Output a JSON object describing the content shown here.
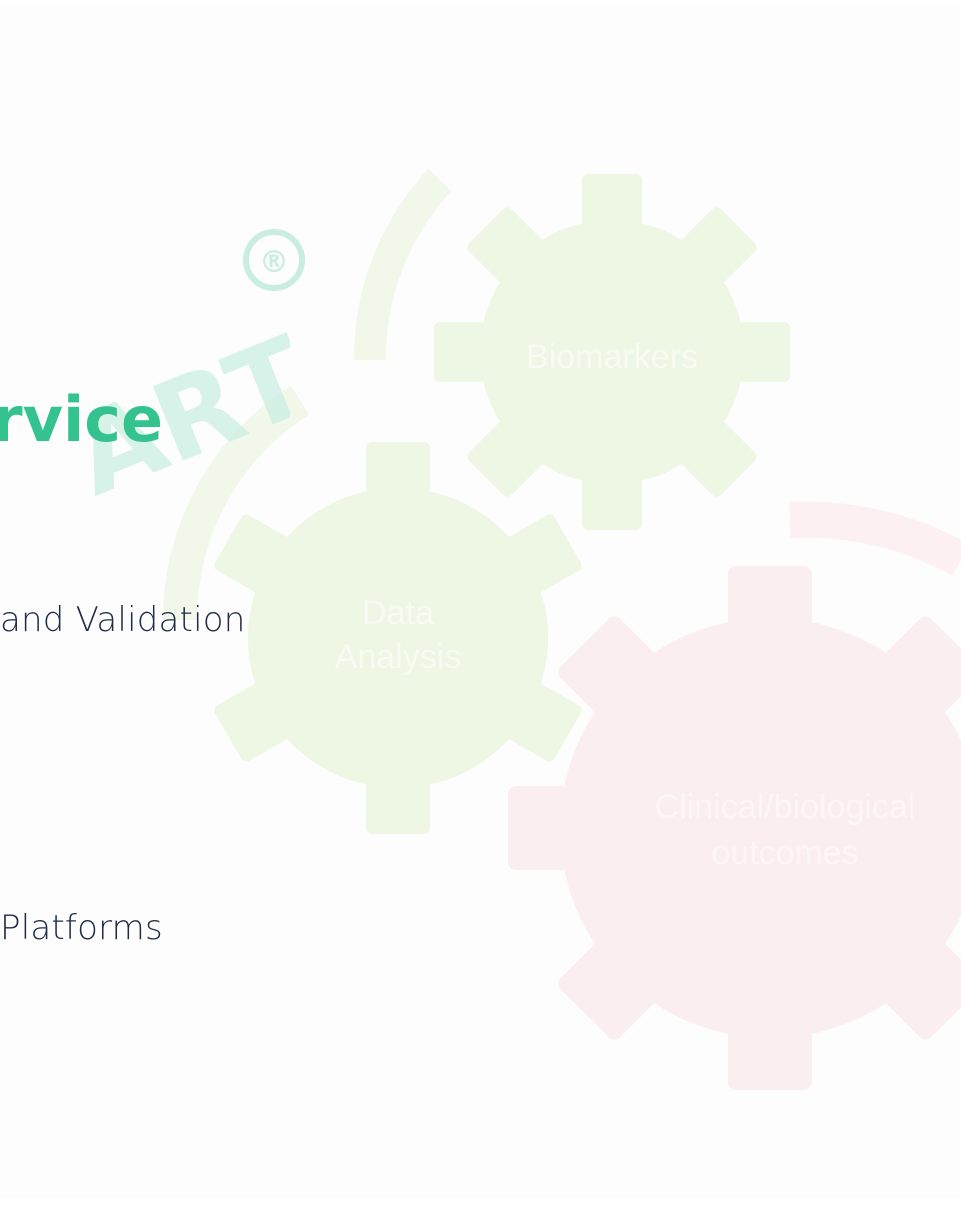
{
  "watermark": {
    "text": "ART",
    "mark": "®"
  },
  "heading": {
    "text": "rvice",
    "color": "#34c38f"
  },
  "lines": [
    "and Validation",
    "Platforms"
  ],
  "gears": [
    {
      "label": "Biomarkers",
      "color": "#eef6e4"
    },
    {
      "label_line1": "Data",
      "label_line2": "Analysis",
      "color": "#eef6e4"
    },
    {
      "label_line1": "Clinical/biological",
      "label_line2": "outcomes",
      "color": "#fbeef0"
    }
  ],
  "colors": {
    "text": "#1f2c47",
    "green_gear": "#eef6e4",
    "pink_gear": "#fbeef0",
    "background": "#fdfdfd"
  }
}
